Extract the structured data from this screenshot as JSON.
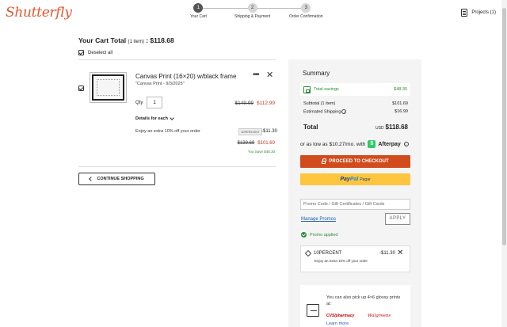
{
  "header": {
    "logo": "Shutterfly",
    "steps": [
      {
        "num": "1",
        "label": "Your Cart"
      },
      {
        "num": "2",
        "label": "Shipping & Payment"
      },
      {
        "num": "3",
        "label": "Order Confirmation"
      }
    ],
    "projects_label": "Projects (1)"
  },
  "cart": {
    "title": "Your Cart Total",
    "item_count": "(1 item)",
    "total": ": $118.68",
    "deselect_label": "Deselect all",
    "item": {
      "title": "Canvas Print (16×20) w/black frame",
      "subtitle": "\"Canvas Print - 9/3/2025\"",
      "qty_label": "Qty",
      "qty_value": "1",
      "price_original": "$149.99",
      "price_sale": "$112.99",
      "details_label": "Details for each",
      "extra_offer": "Enjoy an extra 10% off your order",
      "promo_chip": "10PERCENT",
      "promo_amount": "-$11.30",
      "total_original": "$139.69",
      "total_sale": "$101.69",
      "you_save": "You Save $48.30"
    },
    "continue_label": "CONTINUE SHOPPING"
  },
  "summary": {
    "title": "Summary",
    "savings_label": "Total savings",
    "savings_value": "$48.30",
    "subtotal_label": "Subtotal (1 item)",
    "subtotal_value": "$101.69",
    "shipping_label": "Estimated Shipping",
    "shipping_value": "$16.99",
    "total_label": "Total",
    "currency": "USD",
    "total_value": "$118.68",
    "afterpay_text": "or as low as $10.27/mo. with",
    "afterpay_brand": "Afterpay",
    "checkout_label": "PROCEED TO CHECKOUT",
    "paypal_pay": "Pay",
    "paypal_pal": "Pal",
    "paypal_sub": "Pagar",
    "promo_placeholder": "Promo Code / Gift Certificates / Gift Cards",
    "manage_promos": "Manage Promos",
    "apply_label": "APPLY",
    "promo_applied": "Promo applied",
    "applied_code": "10PERCENT",
    "applied_amount": "-$11.30",
    "applied_desc": "Enjoy an extra 10% off your order",
    "pickup_text": "You can also pick up 4×6 glossy prints at:",
    "pickup_cvs": "CVS/pharmacy",
    "pickup_walgreens": "Walgreens",
    "learn_more": "Learn more"
  },
  "colors": {
    "accent": "#d14b1d",
    "brand": "#e8542e",
    "sale_red": "#c8372d",
    "success_green": "#2f8a3a",
    "paypal_yellow": "#fdc63e"
  }
}
